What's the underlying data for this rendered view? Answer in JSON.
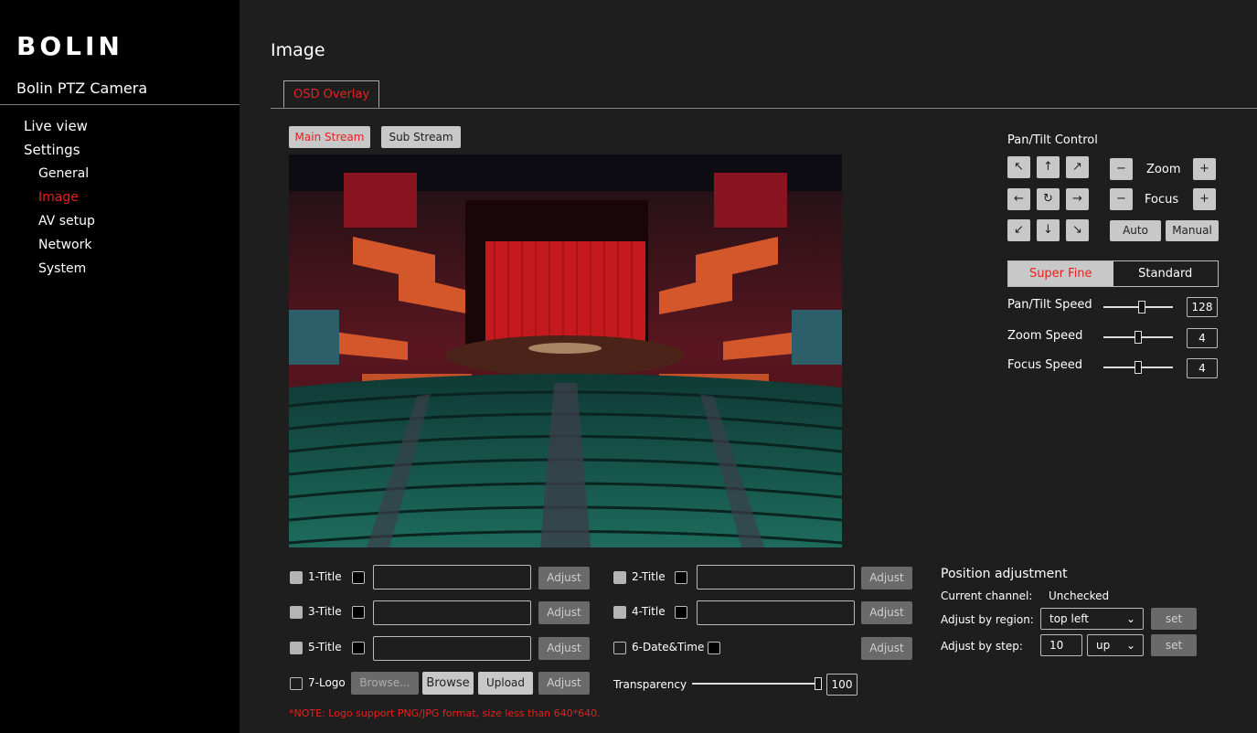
{
  "brand": "BOLIN",
  "camera_name": "Bolin PTZ Camera",
  "nav": {
    "live_view": "Live view",
    "settings": "Settings",
    "general": "General",
    "image": "Image",
    "av_setup": "AV setup",
    "network": "Network",
    "system": "System"
  },
  "page_title": "Image",
  "tab_osd": "OSD Overlay",
  "streams": {
    "main": "Main Stream",
    "sub": "Sub Stream"
  },
  "ptz": {
    "title": "Pan/Tilt Control",
    "zoom_label": "Zoom",
    "focus_label": "Focus",
    "auto": "Auto",
    "manual": "Manual",
    "minus": "−",
    "plus": "+",
    "arrows": {
      "ul": "↖",
      "up": "↑",
      "ur": "↗",
      "left": "←",
      "home": "↻",
      "right": "→",
      "dl": "↙",
      "down": "↓",
      "dr": "↘"
    }
  },
  "quality": {
    "super_fine": "Super Fine",
    "standard": "Standard",
    "selected": "Super Fine"
  },
  "speeds": {
    "pan_tilt_label": "Pan/Tilt Speed",
    "pan_tilt_value": "128",
    "zoom_label": "Zoom Speed",
    "zoom_value": "4",
    "focus_label": "Focus Speed",
    "focus_value": "4"
  },
  "osd": {
    "title1": "1-Title",
    "title2": "2-Title",
    "title3": "3-Title",
    "title4": "4-Title",
    "title5": "5-Title",
    "datetime": "6-Date&Time",
    "logo": "7-Logo",
    "adjust": "Adjust",
    "browse_placeholder": "Browse...",
    "browse": "Browse",
    "upload": "Upload",
    "transparency_label": "Transparency",
    "transparency_value": "100"
  },
  "position": {
    "title": "Position adjustment",
    "current_channel_label": "Current channel:",
    "current_channel_value": "Unchecked",
    "by_region_label": "Adjust by region:",
    "region_value": "top left",
    "by_step_label": "Adjust by step:",
    "step_value": "10",
    "direction_value": "up",
    "set": "set"
  },
  "note": "*NOTE: Logo support PNG/JPG format, size less than 640*640.",
  "colors": {
    "accent": "#e8201e",
    "sidebar_bg": "#000000",
    "main_bg": "#1e1e1e"
  }
}
